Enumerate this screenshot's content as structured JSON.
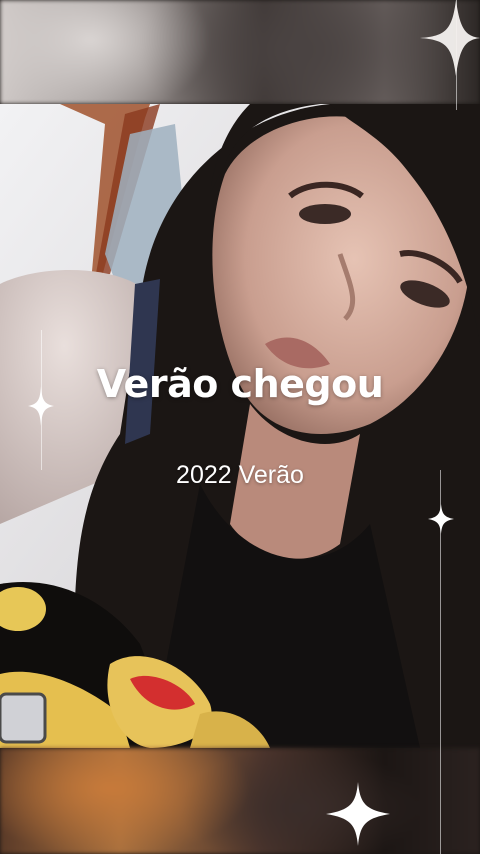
{
  "story": {
    "title": "Verão chegou",
    "subtitle": "2022 Verão"
  },
  "decor": {
    "sparkle_icon": "four-point-star-icon",
    "accent_color": "#ffffff"
  }
}
